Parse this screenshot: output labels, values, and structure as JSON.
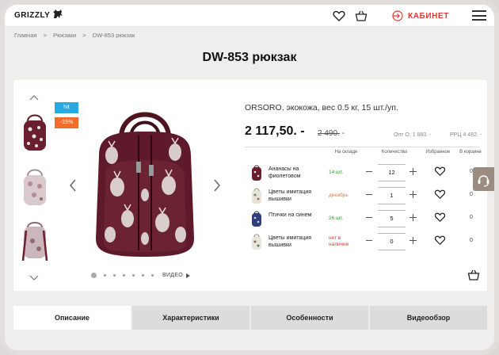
{
  "header": {
    "logo": "GRIZZLY",
    "icons": [
      "heart-icon",
      "cart-icon",
      "menu-icon"
    ],
    "cabinet_label": "КАБИНЕТ",
    "accent": "#e53935"
  },
  "breadcrumbs": [
    "Главная",
    ">",
    "Рюкзаки",
    ">",
    "DW-853 рюкзак"
  ],
  "product": {
    "title": "DW-853 рюкзак",
    "badges": [
      {
        "text": "hit",
        "color": "#29a9e1"
      },
      {
        "text": "-15%",
        "color": "#f26c2b"
      }
    ],
    "description": "ORSORO, экокожа, вес 0.5 кг, 15 шт./уп.",
    "price": "2 117,50. -",
    "old_price": "2 490.",
    "old_price_suffix": " -",
    "opt_price": "Опт О: 1 860. -",
    "rrc_price": "РРЦ 4 482. -",
    "video_label": "ВИДЕО",
    "gallery_dots": 7,
    "gallery_active_index": 0
  },
  "variants_table": {
    "headers": {
      "stock": "На складе",
      "qty": "Количество",
      "fav": "Избранное",
      "cart": "В корзине"
    },
    "rows": [
      {
        "name": "Ананасы на фиолетовом",
        "stock": "14 шт.",
        "stock_color": "#3a9a3a",
        "qty": "12",
        "in_cart": "0"
      },
      {
        "name": "Цветы имитация вышивки",
        "stock": "декабрь",
        "stock_color": "#f07a2a",
        "qty": "1",
        "in_cart": "0"
      },
      {
        "name": "Птички на синем",
        "stock": "26 шт.",
        "stock_color": "#3a9a3a",
        "qty": "5",
        "in_cart": "0"
      },
      {
        "name": "Цветы имитация вышивки",
        "stock": "нет в наличии",
        "stock_color": "#e53935",
        "qty": "0",
        "in_cart": "0"
      }
    ]
  },
  "tabs": [
    "Описание",
    "Характеристики",
    "Особенности",
    "Видеообзор"
  ],
  "active_tab": "Описание"
}
